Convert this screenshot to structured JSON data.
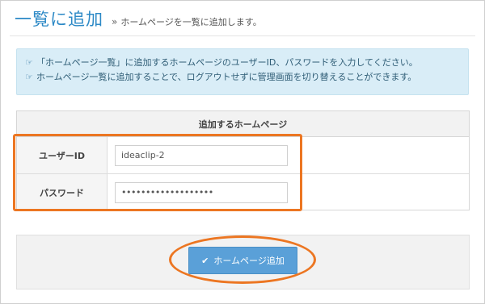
{
  "header": {
    "title": "一覧に追加",
    "chevron": "»",
    "subtitle": "ホームページを一覧に追加します。"
  },
  "info": {
    "icon": "hand-pointer-icon",
    "lines": [
      "「ホームページ一覧」に追加するホームページのユーザーID、パスワードを入力してください。",
      "ホームページ一覧に追加することで、ログアウトせずに管理画面を切り替えることができます。"
    ],
    "background": "#d9edf7"
  },
  "table": {
    "heading": "追加するホームページ",
    "rows": [
      {
        "label": "ユーザーID",
        "value": "ideaclip-2"
      },
      {
        "label": "パスワード",
        "value": "•••••••••••••••••••"
      }
    ]
  },
  "submit": {
    "label": "ホームページ追加",
    "icon": "check-icon",
    "color": "#5aa0d8"
  },
  "highlight_color": "#ec7622",
  "accent_title_color": "#2c89c6"
}
